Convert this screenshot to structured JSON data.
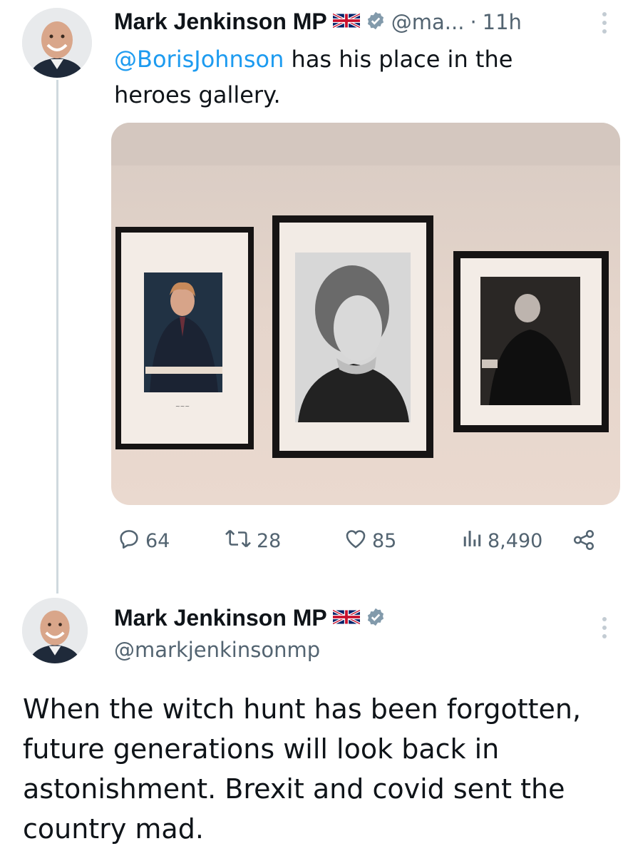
{
  "tweet1": {
    "name": "Mark Jenkinson MP",
    "handle_short": "@ma...",
    "separator": "·",
    "time": "11h",
    "mention": "@BorisJohnson",
    "text_rest": " has his place in the heroes gallery.",
    "actions": {
      "replies": "64",
      "retweets": "28",
      "likes": "85",
      "views": "8,490"
    }
  },
  "tweet2": {
    "name": "Mark Jenkinson MP",
    "handle": "@markjenkinsonmp",
    "text": "When the witch hunt has been forgotten, future generations will look back in astonishment. Brexit and covid sent the country mad."
  },
  "icons": {
    "flag": "uk-flag-icon",
    "verified": "verified-badge-icon",
    "reply": "reply-icon",
    "retweet": "retweet-icon",
    "like": "heart-icon",
    "views": "views-icon",
    "share": "share-icon",
    "more": "more-vertical-icon"
  },
  "colors": {
    "link": "#1d9bf0",
    "text": "#0f1419",
    "muted": "#536471",
    "thread_line": "#cfd9de"
  }
}
